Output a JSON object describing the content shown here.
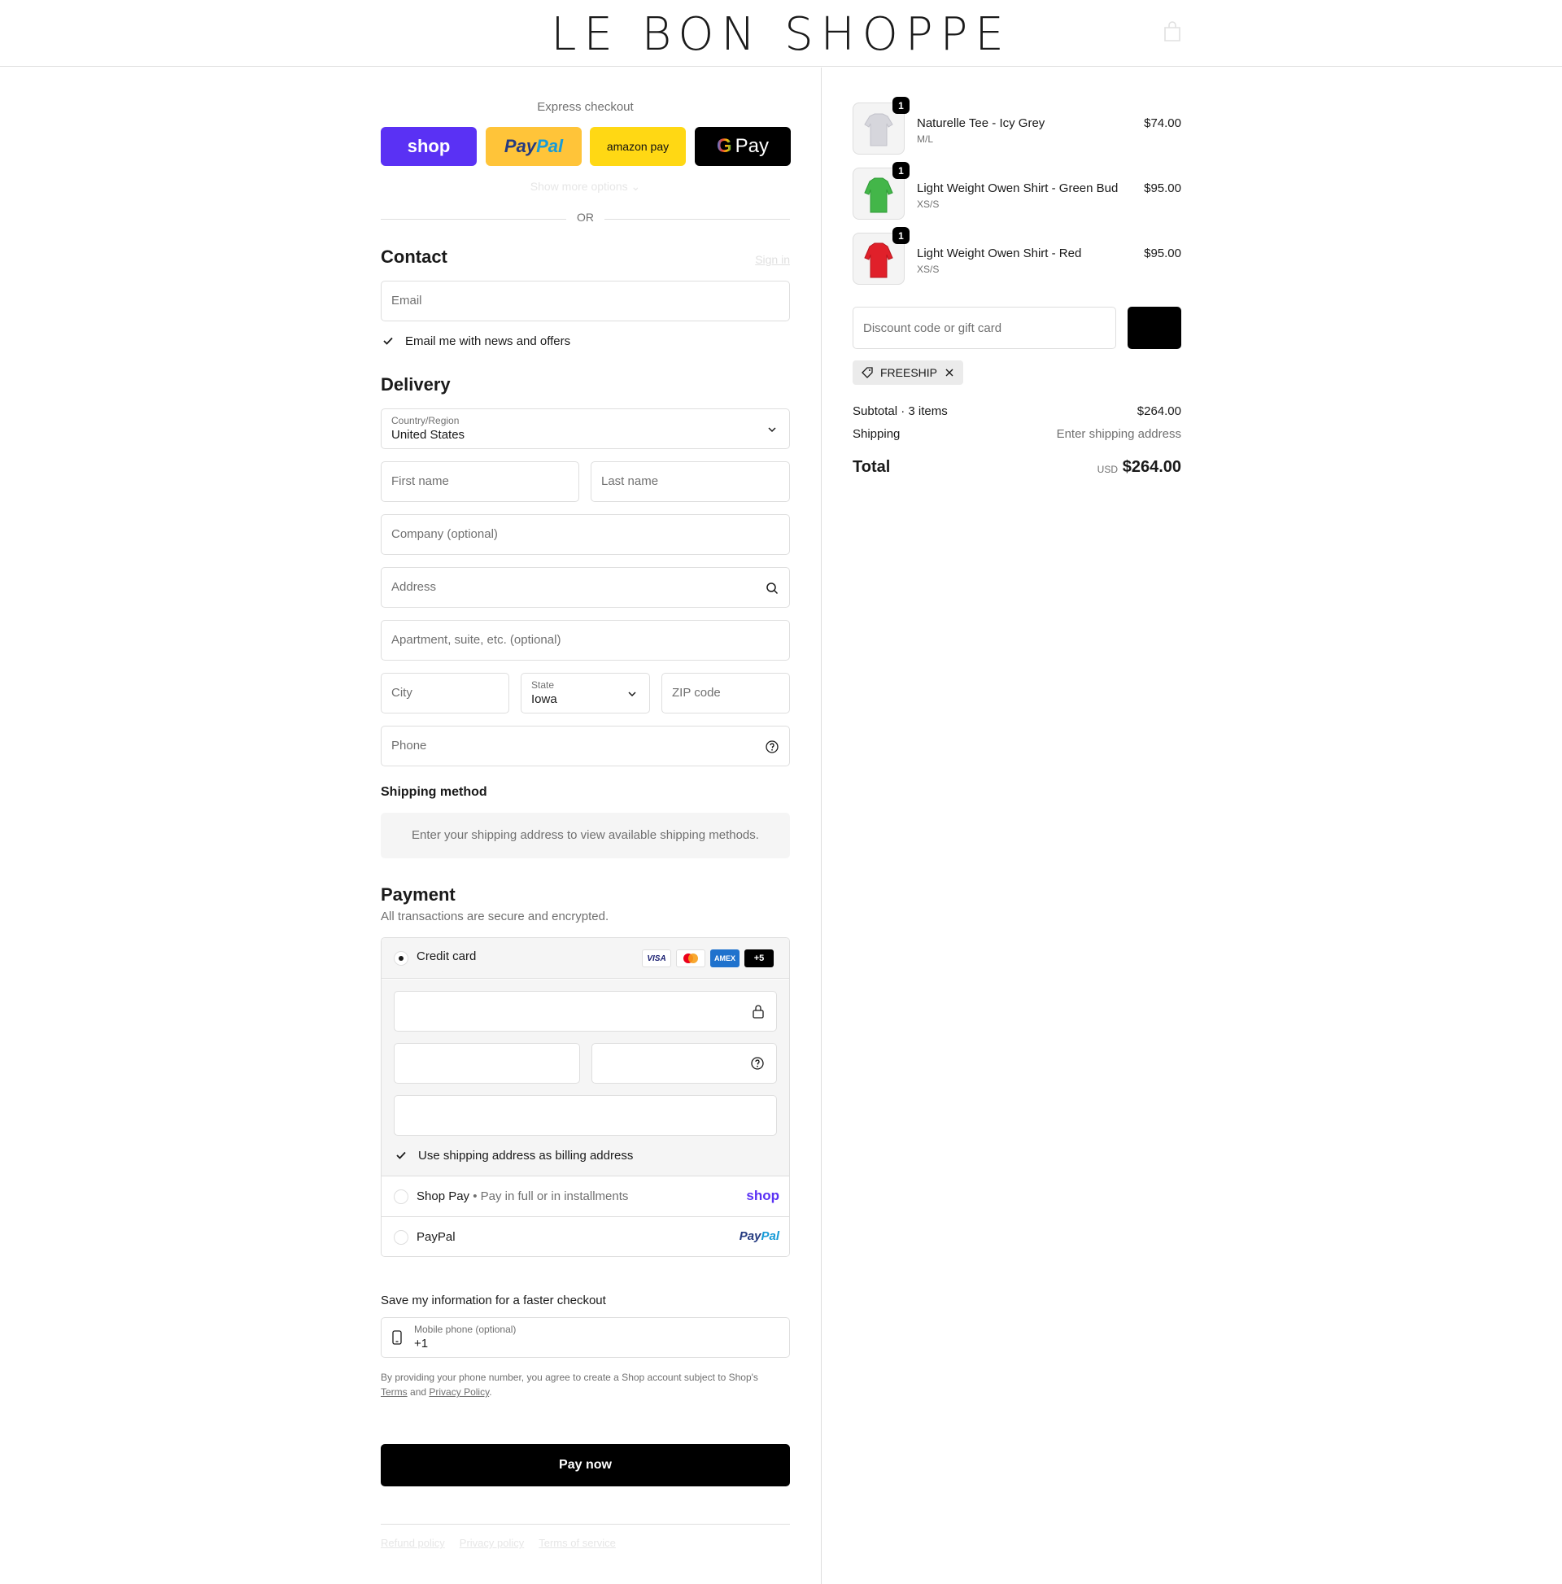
{
  "header": {
    "logo": "LE BON SHOPPE"
  },
  "express": {
    "title": "Express checkout",
    "shop_label": "shop",
    "paypal_a": "Pay",
    "paypal_b": "Pal",
    "amazon_label": "amazon pay",
    "gpay_g": "G",
    "gpay_label": "Pay",
    "more_options": "Show more options",
    "or": "OR"
  },
  "contact": {
    "title": "Contact",
    "sign_in": "Sign in",
    "email_placeholder": "Email",
    "news_label": "Email me with news and offers"
  },
  "delivery": {
    "title": "Delivery",
    "country_label": "Country/Region",
    "country_value": "United States",
    "first_name": "First name",
    "last_name": "Last name",
    "company": "Company (optional)",
    "address": "Address",
    "apartment": "Apartment, suite, etc. (optional)",
    "city": "City",
    "state_label": "State",
    "state_value": "Iowa",
    "zip": "ZIP code",
    "phone": "Phone"
  },
  "shipping_method": {
    "title": "Shipping method",
    "message": "Enter your shipping address to view available shipping methods."
  },
  "payment": {
    "title": "Payment",
    "subtitle": "All transactions are secure and encrypted.",
    "credit_card": "Credit card",
    "badges": {
      "visa": "VISA",
      "amex": "AMEX",
      "more": "+5"
    },
    "billing_same": "Use shipping address as billing address",
    "shop_pay": "Shop Pay",
    "shop_pay_sub": "Pay in full or in installments",
    "shop_pay_logo": "shop",
    "paypal": "PayPal",
    "paypal_logo_a": "Pay",
    "paypal_logo_b": "Pal"
  },
  "save_info": {
    "title": "Save my information for a faster checkout",
    "mobile_label": "Mobile phone (optional)",
    "mobile_value": "+1",
    "legal_text": "By providing your phone number, you agree to create a Shop account subject to Shop's",
    "terms": "Terms",
    "and": "and",
    "privacy": "Privacy Policy",
    "period": "."
  },
  "pay_now": "Pay now",
  "footer": {
    "refund": "Refund policy",
    "privacy": "Privacy policy",
    "terms": "Terms of service"
  },
  "order": {
    "items": [
      {
        "qty": "1",
        "name": "Naturelle Tee - Icy Grey",
        "variant": "M/L",
        "price": "$74.00",
        "color": "#d6d6dc"
      },
      {
        "qty": "1",
        "name": "Light Weight Owen Shirt - Green Bud",
        "variant": "XS/S",
        "price": "$95.00",
        "color": "#43b649"
      },
      {
        "qty": "1",
        "name": "Light Weight Owen Shirt - Red",
        "variant": "XS/S",
        "price": "$95.00",
        "color": "#e0202a"
      }
    ],
    "discount_placeholder": "Discount code or gift card",
    "code": "FREESHIP",
    "subtotal_label": "Subtotal · 3 items",
    "subtotal_value": "$264.00",
    "shipping_label": "Shipping",
    "shipping_value": "Enter shipping address",
    "total_label": "Total",
    "currency": "USD",
    "total_value": "$264.00"
  },
  "colors": {
    "shop_purple": "#5a31f4",
    "paypal_yellow": "#ffc439",
    "amazon_yellow": "#ffd814",
    "border": "#dedede"
  }
}
